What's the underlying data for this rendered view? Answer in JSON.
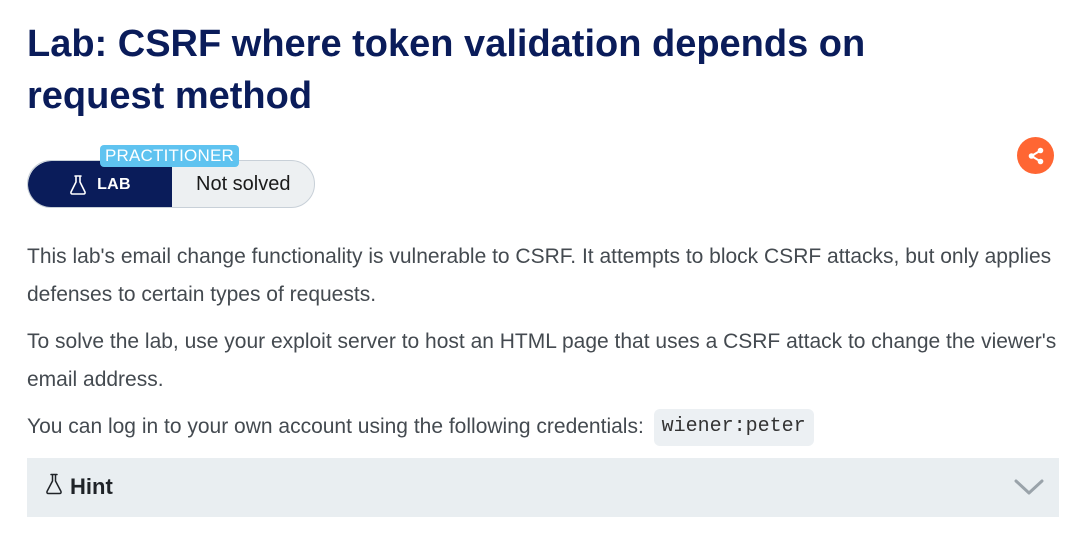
{
  "lab": {
    "title": "Lab: CSRF where token validation depends on request method",
    "level_badge": "PRACTITIONER",
    "lab_label": "LAB",
    "status": "Not solved"
  },
  "description": {
    "paragraph_1": "This lab's email change functionality is vulnerable to CSRF. It attempts to block CSRF attacks, but only applies defenses to certain types of requests.",
    "paragraph_2": "To solve the lab, use your exploit server to host an HTML page that uses a CSRF attack to change the viewer's email address.",
    "paragraph_3": "You can log in to your own account using the following credentials:",
    "credentials": "wiener:peter"
  },
  "hint": {
    "label": "Hint"
  },
  "icons": {
    "lab": "flask-icon",
    "share": "share-icon",
    "hint": "flask-icon",
    "expand": "chevron-down-icon"
  },
  "colors": {
    "title": "#0a1c5a",
    "lab_pill": "#0a1c5a",
    "level_badge": "#5fc3f0",
    "share_button": "#ff6633",
    "hint_bar": "#e9eef1"
  }
}
